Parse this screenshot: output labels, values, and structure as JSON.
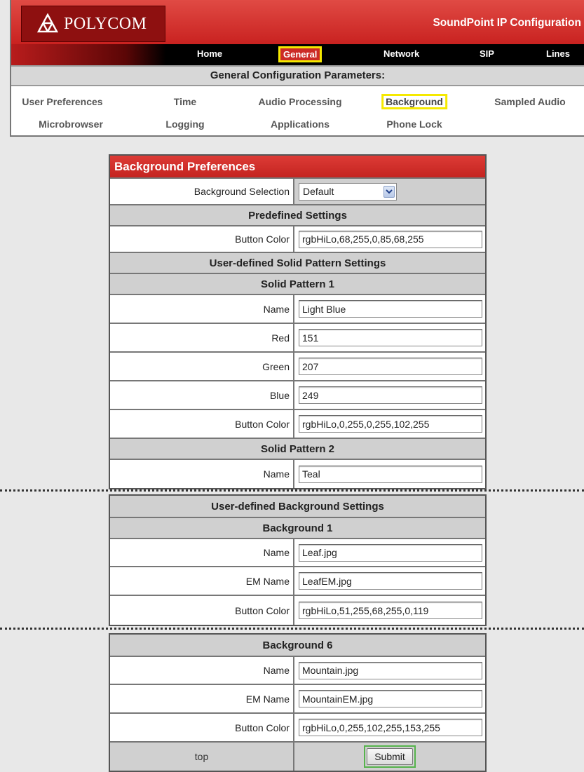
{
  "header": {
    "logo_text": "POLYCOM",
    "app_title": "SoundPoint IP Configuration",
    "nav": [
      "Home",
      "General",
      "Network",
      "SIP",
      "Lines"
    ],
    "active_nav": "General",
    "subhead": "General Configuration Parameters:",
    "subnav_row1": [
      "User Preferences",
      "Time",
      "Audio Processing",
      "Background",
      "Sampled Audio"
    ],
    "subnav_row2": [
      "Microbrowser",
      "Logging",
      "Applications",
      "Phone Lock"
    ],
    "active_subnav": "Background"
  },
  "panel1": {
    "title": "Background Preferences",
    "background_selection": {
      "label": "Background Selection",
      "value": "Default"
    },
    "predefined": {
      "heading": "Predefined Settings",
      "button_color": {
        "label": "Button Color",
        "value": "rgbHiLo,68,255,0,85,68,255"
      }
    },
    "solid_heading": "User-defined Solid Pattern Settings",
    "solid1": {
      "heading": "Solid Pattern 1",
      "fields": [
        {
          "label": "Name",
          "value": "Light Blue"
        },
        {
          "label": "Red",
          "value": "151"
        },
        {
          "label": "Green",
          "value": "207"
        },
        {
          "label": "Blue",
          "value": "249"
        },
        {
          "label": "Button Color",
          "value": "rgbHiLo,0,255,0,255,102,255"
        }
      ]
    },
    "solid2": {
      "heading": "Solid Pattern 2",
      "fields": [
        {
          "label": "Name",
          "value": "Teal"
        }
      ]
    }
  },
  "panel2": {
    "heading": "User-defined Background Settings",
    "bg1": {
      "heading": "Background 1",
      "fields": [
        {
          "label": "Name",
          "value": "Leaf.jpg"
        },
        {
          "label": "EM Name",
          "value": "LeafEM.jpg"
        },
        {
          "label": "Button Color",
          "value": "rgbHiLo,51,255,68,255,0,119"
        }
      ]
    }
  },
  "panel3": {
    "bg6": {
      "heading": "Background 6",
      "fields": [
        {
          "label": "Name",
          "value": "Mountain.jpg"
        },
        {
          "label": "EM Name",
          "value": "MountainEM.jpg"
        },
        {
          "label": "Button Color",
          "value": "rgbHiLo,0,255,102,255,153,255"
        }
      ]
    },
    "top_link": "top",
    "submit_label": "Submit"
  }
}
